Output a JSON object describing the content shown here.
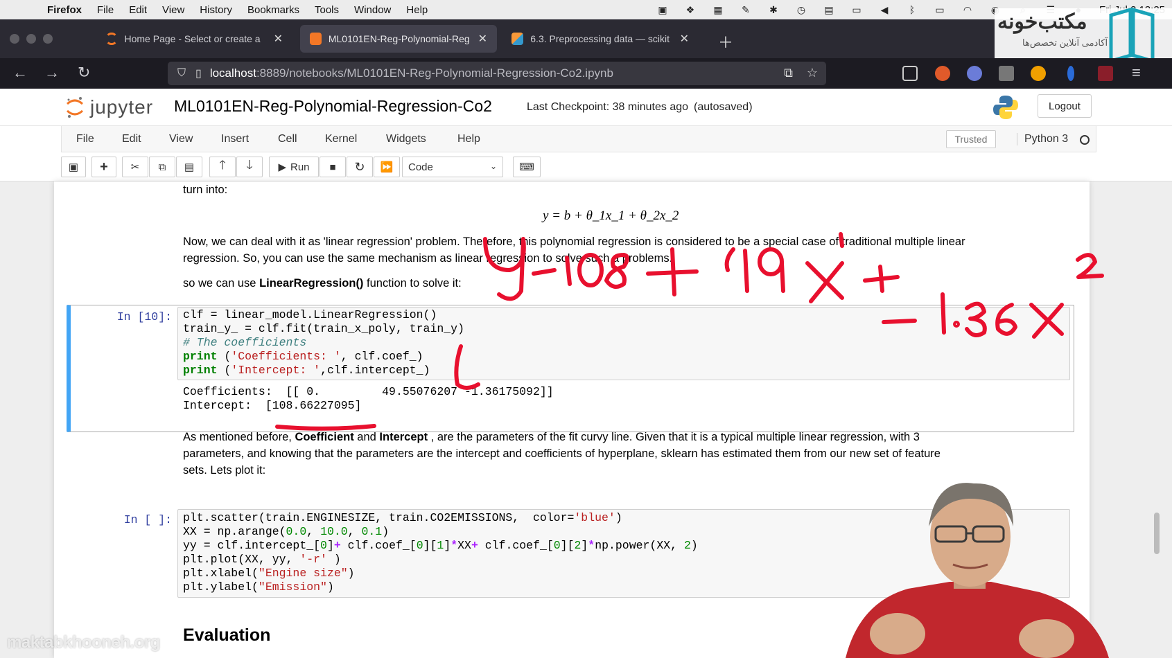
{
  "menubar": {
    "app": "Firefox",
    "items": [
      "File",
      "Edit",
      "View",
      "History",
      "Bookmarks",
      "Tools",
      "Window",
      "Help"
    ],
    "clock": "Fri Jul 2  12:25"
  },
  "tabs": [
    {
      "title": "Home Page - Select or create a",
      "active": false
    },
    {
      "title": "ML0101EN-Reg-Polynomial-Reg",
      "active": true
    },
    {
      "title": "6.3. Preprocessing data — scikit",
      "active": false
    }
  ],
  "brand": {
    "name": "مکتب‌خونه",
    "tagline": "آکادمی آنلاین تخصص‌ها"
  },
  "urlbar": {
    "host": "localhost",
    "path": ":8889/notebooks/ML0101EN-Reg-Polynomial-Regression-Co2.ipynb"
  },
  "jupyter": {
    "logo_word": "jupyter",
    "notebook_title": "ML0101EN-Reg-Polynomial-Regression-Co2",
    "checkpoint": "Last Checkpoint: 38 minutes ago",
    "autosaved": "(autosaved)",
    "logout": "Logout",
    "menu": [
      "File",
      "Edit",
      "View",
      "Insert",
      "Cell",
      "Kernel",
      "Widgets",
      "Help"
    ],
    "trusted": "Trusted",
    "kernel": "Python 3",
    "toolbar": {
      "run": "Run",
      "cell_type": "Code"
    }
  },
  "notebook": {
    "md1": "turn into:",
    "equation": "y = b + θ_1x_1 + θ_2x_2",
    "md2_line1": "Now, we can deal with it as 'linear regression' problem. Therefore, this polynomial regression is considered to be a special case of traditional multiple linear",
    "md2_line2": "regression. So, you can use the same mechanism as linear regression to solve such a problems.",
    "md3_pre": "so we can use ",
    "md3_bold": "LinearRegression()",
    "md3_post": " function to solve it:",
    "cell10_prompt": "In [10]:",
    "cell10_output_line1": "Coefficients:  [[ 0.         49.55076207 -1.36175092]]",
    "cell10_output_line2": "Intercept:  [108.66227095]",
    "md4_l1_a": "As mentioned before, ",
    "md4_l1_b1": "Coefficient",
    "md4_l1_c": " and ",
    "md4_l1_b2": "Intercept",
    "md4_l1_d": " , are the parameters of the fit curvy line. Given that it is a typical multiple linear regression, with 3",
    "md4_l2": "parameters, and knowing that the parameters are the intercept and coefficients of hyperplane, sklearn has estimated them from our new set of feature",
    "md4_l3": "sets. Lets plot it:",
    "cell11_prompt": "In [ ]:",
    "heading_evaluation": "Evaluation"
  },
  "watermark": "maktabkhooneh.org",
  "ink_color": "#e8102e"
}
